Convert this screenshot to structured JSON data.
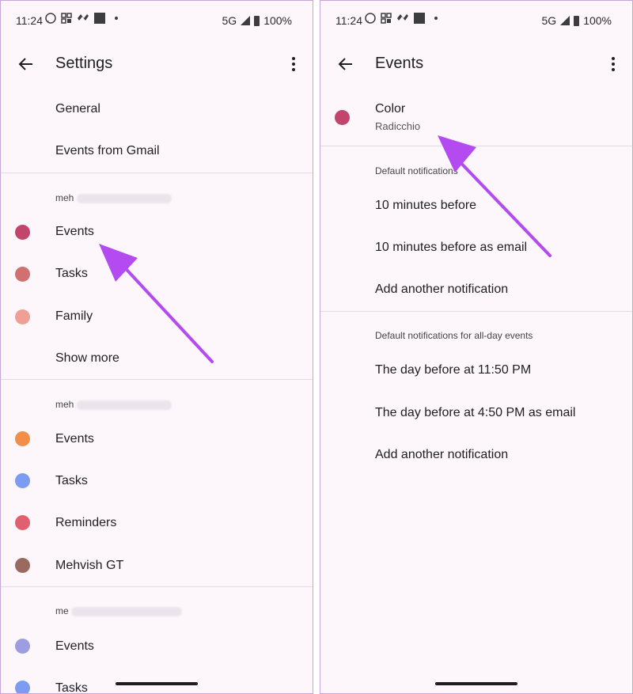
{
  "left": {
    "status": {
      "time": "11:24",
      "network": "5G",
      "battery": "100%"
    },
    "title": "Settings",
    "items": {
      "general": "General",
      "gmail": "Events from Gmail",
      "account1": "meh",
      "a1_events": "Events",
      "a1_tasks": "Tasks",
      "a1_family": "Family",
      "a1_more": "Show more",
      "account2": "meh",
      "a2_events": "Events",
      "a2_tasks": "Tasks",
      "a2_reminders": "Reminders",
      "a2_mehvish": "Mehvish GT",
      "account3": "me",
      "a3_events": "Events",
      "a3_tasks": "Tasks"
    },
    "colors": {
      "a1_events": "#c2466c",
      "a1_tasks": "#d07070",
      "a1_family": "#ef9f95",
      "a2_events": "#f08e4a",
      "a2_tasks": "#7b9cf0",
      "a2_reminders": "#e06070",
      "a2_mehvish": "#9a6a60",
      "a3_events": "#9d9ee0",
      "a3_tasks": "#7b9cf0"
    }
  },
  "right": {
    "status": {
      "time": "11:24",
      "network": "5G",
      "battery": "100%"
    },
    "title": "Events",
    "color_label": "Color",
    "color_value": "Radicchio",
    "color_hex": "#c2466c",
    "default_notif_header": "Default notifications",
    "notif1": "10 minutes before",
    "notif2": "10 minutes before as email",
    "add_notif": "Add another notification",
    "allday_header": "Default notifications for all-day events",
    "allday1": "The day before at 11:50 PM",
    "allday2": "The day before at 4:50 PM as email",
    "allday_add": "Add another notification"
  },
  "icons": {
    "back": "arrow-back-icon",
    "more": "more-vert-icon",
    "whatsapp": "whatsapp-icon",
    "signal": "signal-icon",
    "battery": "battery-icon"
  },
  "accent": "#b44bf0"
}
